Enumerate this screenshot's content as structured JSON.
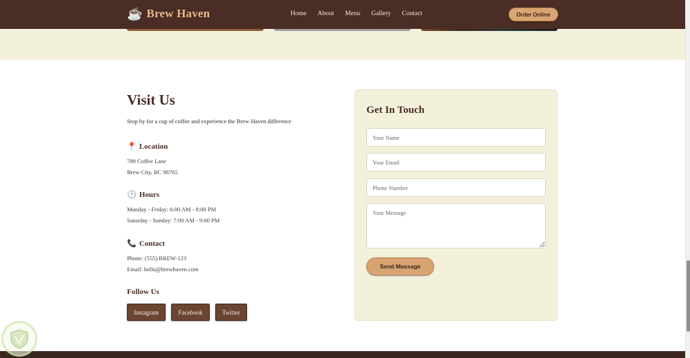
{
  "nav": {
    "brand": "Brew Haven",
    "links": [
      "Home",
      "About",
      "Menu",
      "Gallery",
      "Contact"
    ],
    "order_label": "Order Online"
  },
  "visit": {
    "title": "Visit Us",
    "subtitle": "Stop by for a cup of coffee and experience the Brew Haven difference",
    "location": {
      "icon": "map-pin",
      "heading": "Location",
      "lines": [
        "789 Coffee Lane",
        "Brew City, BC 98765"
      ]
    },
    "hours": {
      "icon": "clock",
      "heading": "Hours",
      "lines": [
        "Monday - Friday: 6:00 AM - 8:00 PM",
        "Saturday - Sunday: 7:00 AM - 9:00 PM"
      ]
    },
    "contact": {
      "icon": "phone",
      "heading": "Contact",
      "lines": [
        "Phone: (555) BREW-123",
        "Email: hello@brewhaven.com"
      ]
    },
    "follow": {
      "heading": "Follow Us",
      "links": [
        "Instagram",
        "Facebook",
        "Twitter"
      ]
    }
  },
  "form": {
    "title": "Get In Touch",
    "name_placeholder": "Your Name",
    "email_placeholder": "Your Email",
    "phone_placeholder": "Phone Number",
    "message_placeholder": "Your Message",
    "submit_label": "Send Message"
  },
  "colors": {
    "nav_bg": "#4a2d24",
    "accent": "#d9a472",
    "cream": "#f3f1dc",
    "heading": "#4a2d24"
  }
}
